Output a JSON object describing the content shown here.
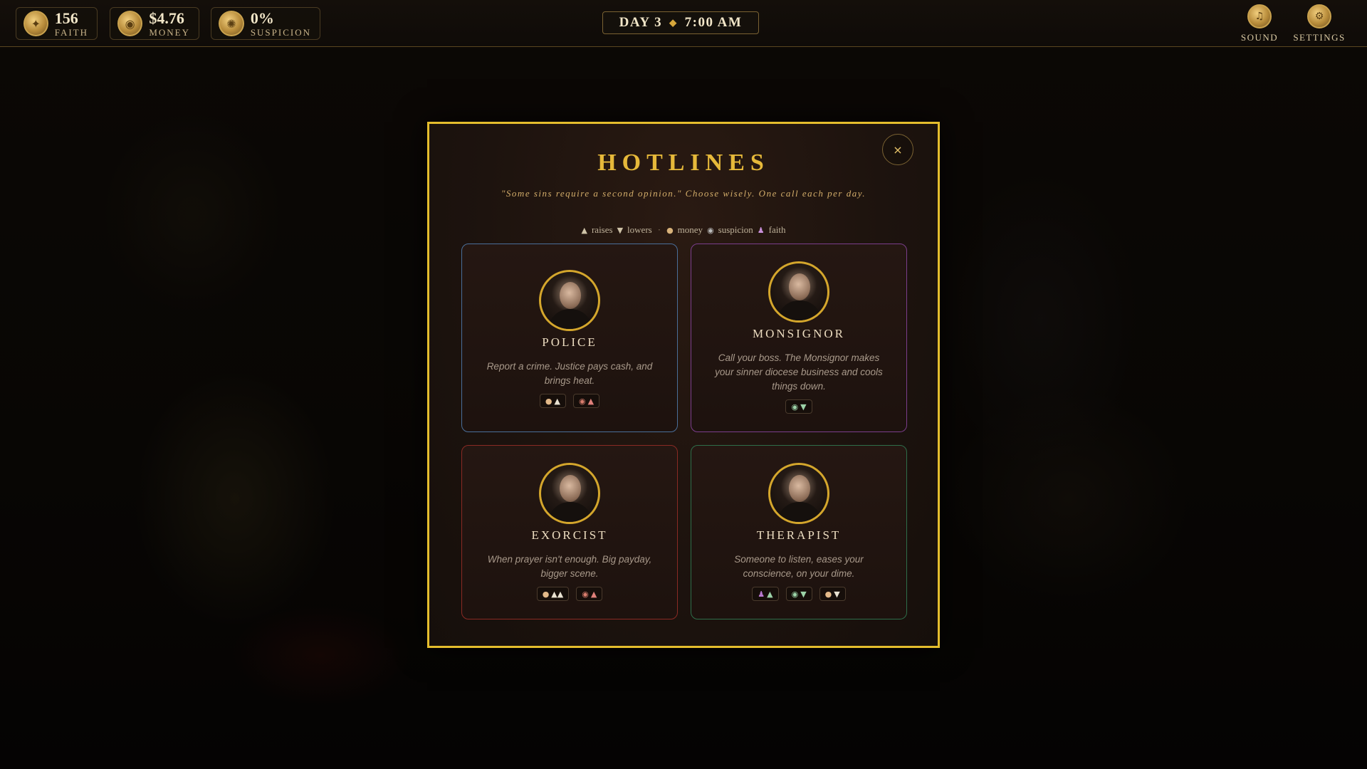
{
  "stats": {
    "faith": {
      "value": "156",
      "label": "Faith",
      "icon": "faith-coin-icon"
    },
    "money": {
      "value": "$4.76",
      "label": "Money",
      "icon": "money-coin-icon"
    },
    "suspicion": {
      "value": "0%",
      "label": "Suspicion",
      "icon": "suspicion-coin-icon"
    }
  },
  "clock": {
    "day": "DAY 3",
    "time": "7:00 AM"
  },
  "controls": {
    "sound_label": "Sound",
    "settings_label": "Settings"
  },
  "modal": {
    "title": "HOTLINES",
    "subtitle": "\"Some sins require a second opinion.\" Choose wisely. One call each per day.",
    "close_symbol": "×",
    "legend": {
      "raises": "raises",
      "lowers": "lowers",
      "money": "money",
      "suspicion": "suspicion",
      "faith": "faith"
    },
    "cards": [
      {
        "name": "Police",
        "desc": "Report a crime. Justice pays cash, and brings heat.",
        "border_color": "#4a6f9a"
      },
      {
        "name": "Monsignor",
        "desc": "Call your boss. The Monsignor makes your sinner diocese business and cools things down.",
        "border_color": "#7b3e8c"
      },
      {
        "name": "Exorcist",
        "desc": "When prayer isn't enough. Big payday, bigger scene.",
        "border_color": "#8a2a24"
      },
      {
        "name": "Therapist",
        "desc": "Someone to listen, eases your conscience, on your dime.",
        "border_color": "#2e6e4a"
      }
    ]
  },
  "colors": {
    "accent_gold": "#e4bd2d",
    "title_gold": "#e6b93a"
  }
}
